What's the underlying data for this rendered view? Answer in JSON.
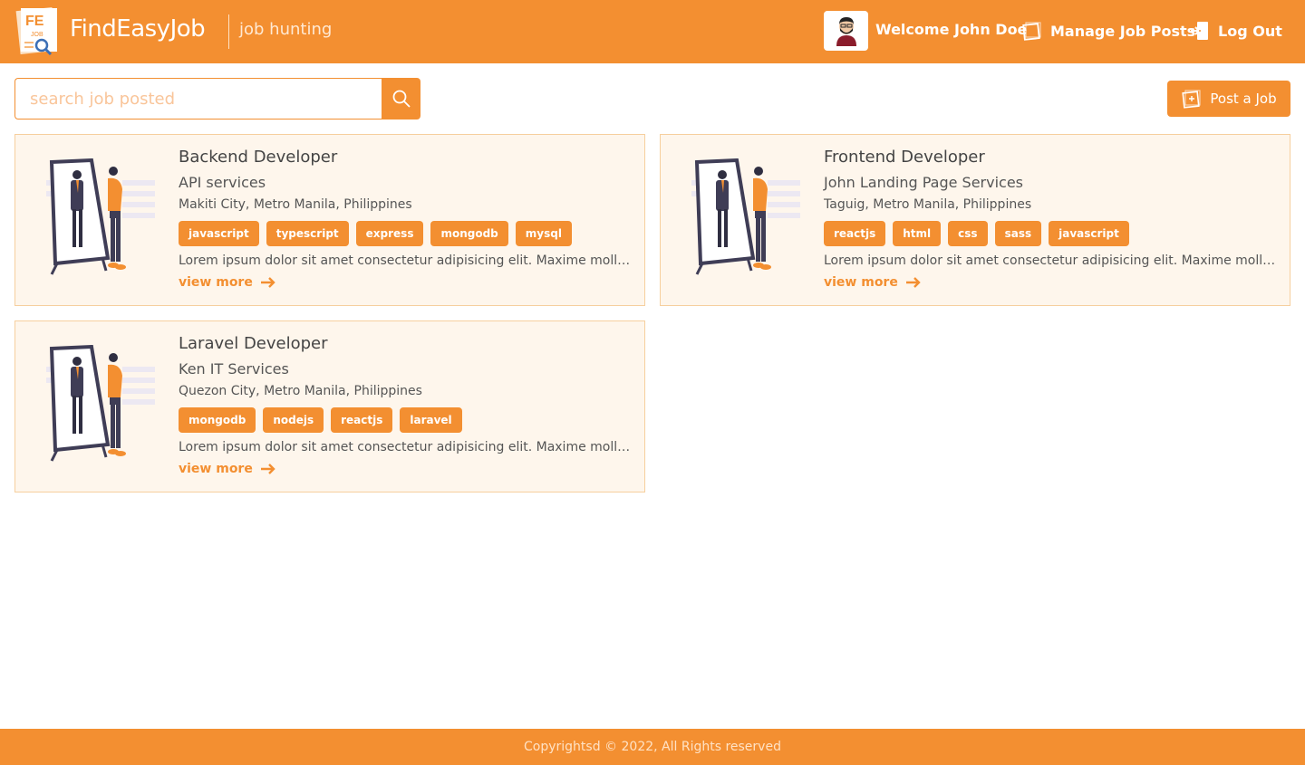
{
  "header": {
    "brand": "FindEasyJob",
    "tagline": "job hunting",
    "logo_text_top": "FE",
    "logo_text_sub": "JOB",
    "welcome": "Welcome John Doe",
    "manage_label": "Manage Job Posts",
    "logout_label": "Log Out"
  },
  "search": {
    "placeholder": "search job posted",
    "value": ""
  },
  "toolbar": {
    "post_label": "Post a Job"
  },
  "jobs": [
    {
      "title": "Backend Developer",
      "company": "API services",
      "location": "Makiti City, Metro Manila, Philippines",
      "tags": [
        "javascript",
        "typescript",
        "express",
        "mongodb",
        "mysql"
      ],
      "description": "Lorem ipsum dolor sit amet consectetur adipisicing elit. Maxime mollitia, ...",
      "view_more": "view more"
    },
    {
      "title": "Frontend Developer",
      "company": "John Landing Page Services",
      "location": "Taguig, Metro Manila, Philippines",
      "tags": [
        "reactjs",
        "html",
        "css",
        "sass",
        "javascript"
      ],
      "description": "Lorem ipsum dolor sit amet consectetur adipisicing elit. Maxime mollitia, ...",
      "view_more": "view more"
    },
    {
      "title": "Laravel Developer",
      "company": "Ken IT Services",
      "location": "Quezon City, Metro Manila, Philippines",
      "tags": [
        "mongodb",
        "nodejs",
        "reactjs",
        "laravel"
      ],
      "description": "Lorem ipsum dolor sit amet consectetur adipisicing elit. Maxime mollitia, ...",
      "view_more": "view more"
    }
  ],
  "footer": {
    "text": "Copyrightsd © 2022, All Rights reserved"
  },
  "colors": {
    "accent": "#F38F31",
    "card_bg": "#FEF6EC",
    "card_border": "#f6cf9e"
  },
  "icons": [
    "logo",
    "avatar-icon",
    "manage-posts-icon",
    "logout-icon",
    "search-icon",
    "post-job-icon",
    "mirror-illustration",
    "arrow-right-icon"
  ]
}
